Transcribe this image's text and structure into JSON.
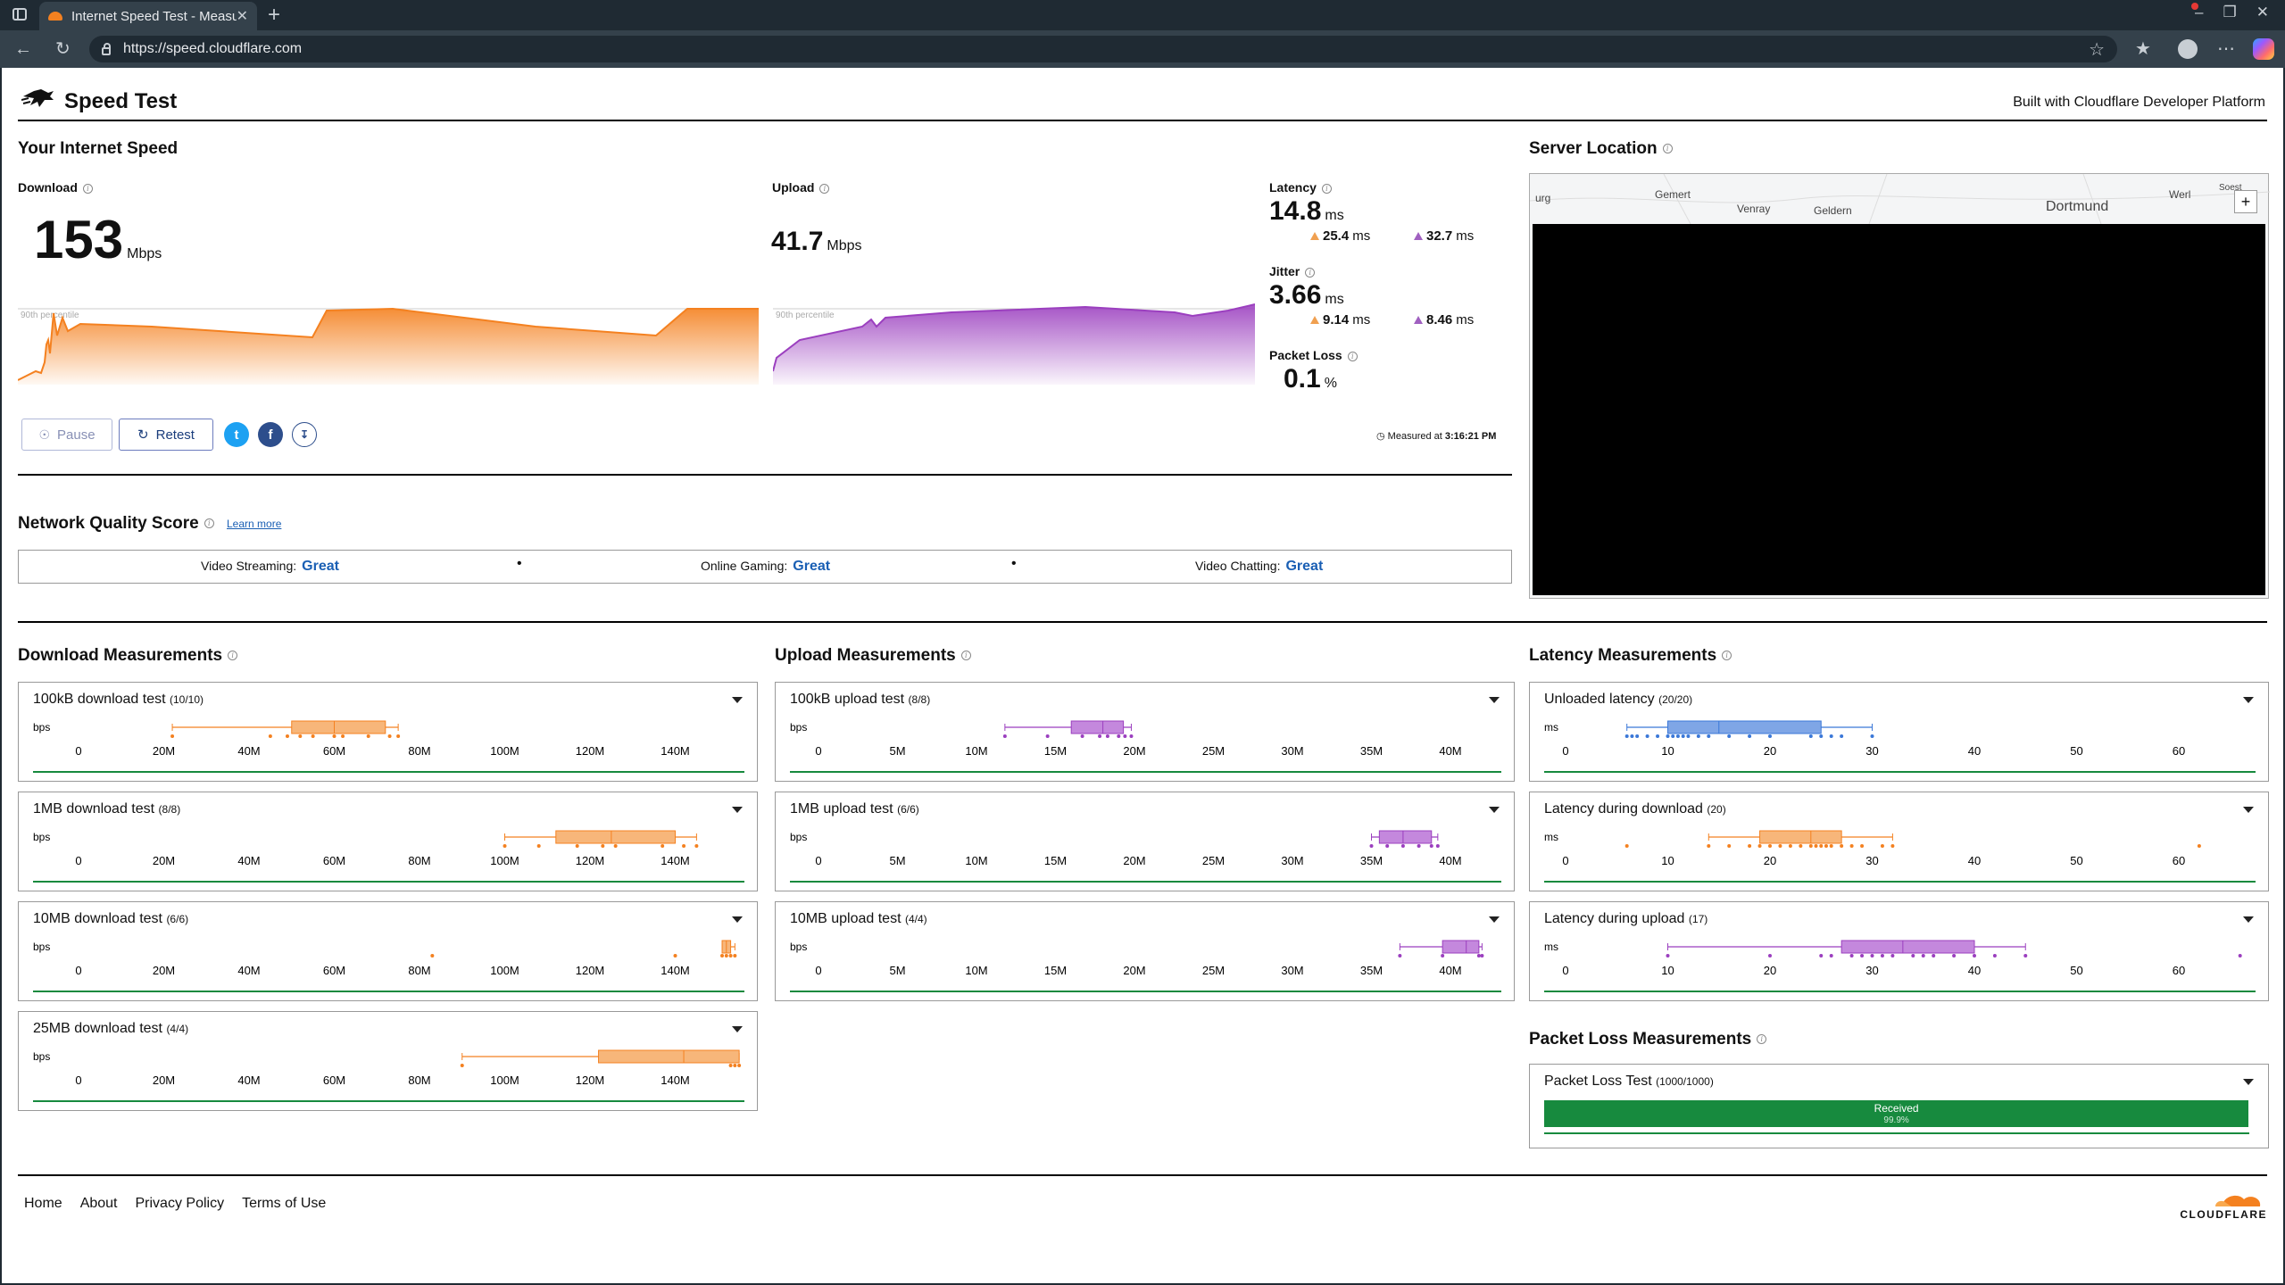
{
  "browser": {
    "tab_title": "Internet Speed Test - Measure Network Performance",
    "url": "https://speed.cloudflare.com",
    "tab_close": "✕",
    "new_tab": "+"
  },
  "header": {
    "title": "Speed Test",
    "built_with": "Built with Cloudflare Developer Platform"
  },
  "speed": {
    "section_title": "Your Internet Speed",
    "download": {
      "label": "Download",
      "value": "153",
      "unit": "Mbps",
      "percentile_label": "90th percentile"
    },
    "upload": {
      "label": "Upload",
      "value": "41.7",
      "unit": "Mbps",
      "percentile_label": "90th percentile"
    },
    "latency": {
      "label": "Latency",
      "value": "14.8",
      "unit": "ms",
      "down": "25.4",
      "up": "32.7",
      "sub_unit": "ms"
    },
    "jitter": {
      "label": "Jitter",
      "value": "3.66",
      "unit": "ms",
      "down": "9.14",
      "up": "8.46",
      "sub_unit": "ms"
    },
    "packet_loss": {
      "label": "Packet Loss",
      "value": "0.1",
      "unit": "%"
    },
    "pause_label": "Pause",
    "retest_label": "Retest",
    "measured_prefix": "Measured at",
    "measured_time": "3:16:21 PM"
  },
  "server": {
    "section_title": "Server Location",
    "map_labels": [
      "urg",
      "Gemert",
      "Venray",
      "Geldern",
      "Dortmund",
      "Werl",
      "Soest"
    ],
    "zoom_label": "+"
  },
  "network_quality": {
    "title": "Network Quality Score",
    "learn_more": "Learn more",
    "items": [
      {
        "label": "Video Streaming:",
        "value": "Great"
      },
      {
        "label": "Online Gaming:",
        "value": "Great"
      },
      {
        "label": "Video Chatting:",
        "value": "Great"
      }
    ],
    "separator": "•"
  },
  "download_measurements": {
    "title": "Download Measurements",
    "unit": "bps",
    "ticks": [
      "0",
      "20M",
      "40M",
      "60M",
      "80M",
      "100M",
      "120M",
      "140M"
    ],
    "tests": [
      {
        "name": "100kB download test",
        "count": "(10/10)",
        "whisker": [
          22,
          75
        ],
        "box": [
          50,
          72
        ],
        "median": 60,
        "points": [
          22,
          45,
          49,
          52,
          55,
          60,
          62,
          68,
          73,
          75
        ]
      },
      {
        "name": "1MB download test",
        "count": "(8/8)",
        "whisker": [
          100,
          145
        ],
        "box": [
          112,
          140
        ],
        "median": 125,
        "points": [
          100,
          108,
          117,
          123,
          126,
          137,
          142,
          145
        ]
      },
      {
        "name": "10MB download test",
        "count": "(6/6)",
        "whisker": [
          151,
          154
        ],
        "box": [
          151,
          153
        ],
        "median": 152,
        "points": [
          83,
          140,
          151,
          152,
          153,
          154
        ]
      },
      {
        "name": "25MB download test",
        "count": "(4/4)",
        "whisker": [
          90,
          155
        ],
        "box": [
          122,
          155
        ],
        "median": 142,
        "points": [
          90,
          153,
          154,
          155
        ]
      }
    ]
  },
  "upload_measurements": {
    "title": "Upload Measurements",
    "unit": "bps",
    "ticks": [
      "0",
      "5M",
      "10M",
      "15M",
      "20M",
      "25M",
      "30M",
      "35M",
      "40M"
    ],
    "tests": [
      {
        "name": "100kB upload test",
        "count": "(8/8)",
        "whisker": [
          11.8,
          19.8
        ],
        "box": [
          16.0,
          19.3
        ],
        "median": 18.0,
        "points": [
          11.8,
          14.5,
          16.7,
          17.8,
          18.3,
          19.0,
          19.4,
          19.8
        ]
      },
      {
        "name": "1MB upload test",
        "count": "(6/6)",
        "whisker": [
          35.0,
          39.2
        ],
        "box": [
          35.5,
          38.8
        ],
        "median": 37.0,
        "points": [
          35.0,
          36.0,
          37.0,
          38.0,
          38.8,
          39.2
        ]
      },
      {
        "name": "10MB upload test",
        "count": "(4/4)",
        "whisker": [
          36.8,
          42.0
        ],
        "box": [
          39.5,
          41.8
        ],
        "median": 41.0,
        "points": [
          36.8,
          39.5,
          41.8,
          42.0
        ]
      }
    ]
  },
  "latency_measurements": {
    "title": "Latency Measurements",
    "unit": "ms",
    "ticks": [
      "0",
      "10",
      "20",
      "30",
      "40",
      "50",
      "60"
    ],
    "tests": [
      {
        "name": "Unloaded latency",
        "count": "(20/20)",
        "whisker": [
          6,
          30
        ],
        "box": [
          10,
          25
        ],
        "median": 15,
        "points": [
          6,
          6.5,
          7,
          8,
          9,
          10,
          10.5,
          11,
          11.5,
          12,
          13,
          14,
          16,
          18,
          20,
          24,
          25,
          26,
          27,
          30
        ]
      },
      {
        "name": "Latency during download",
        "count": "(20)",
        "whisker": [
          14,
          32
        ],
        "box": [
          19,
          27
        ],
        "median": 24,
        "points": [
          6,
          14,
          16,
          18,
          19,
          20,
          21,
          22,
          23,
          24,
          24.5,
          25,
          25.5,
          26,
          27,
          28,
          29,
          31,
          32,
          62
        ]
      },
      {
        "name": "Latency during upload",
        "count": "(17)",
        "whisker": [
          10,
          45
        ],
        "box": [
          27,
          40
        ],
        "median": 33,
        "points": [
          10,
          20,
          25,
          26,
          28,
          29,
          30,
          31,
          32,
          34,
          35,
          36,
          38,
          40,
          42,
          45,
          66
        ]
      }
    ]
  },
  "packet_loss_measurements": {
    "title": "Packet Loss Measurements",
    "test_name": "Packet Loss Test",
    "count": "(1000/1000)",
    "bar_label": "Received",
    "bar_value": "99.9%",
    "received_fraction": 0.999
  },
  "footer": {
    "links": [
      "Home",
      "About",
      "Privacy Policy",
      "Terms of Use"
    ],
    "brand": "CLOUDFLARE"
  },
  "colors": {
    "download": "#f48120",
    "download_fill": "#f7b67a",
    "upload": "#9b3fbf",
    "upload_fill": "#c488dd",
    "latency_unloaded": "#3b78d8",
    "good": "#178a3e",
    "link": "#1a5fb4"
  }
}
